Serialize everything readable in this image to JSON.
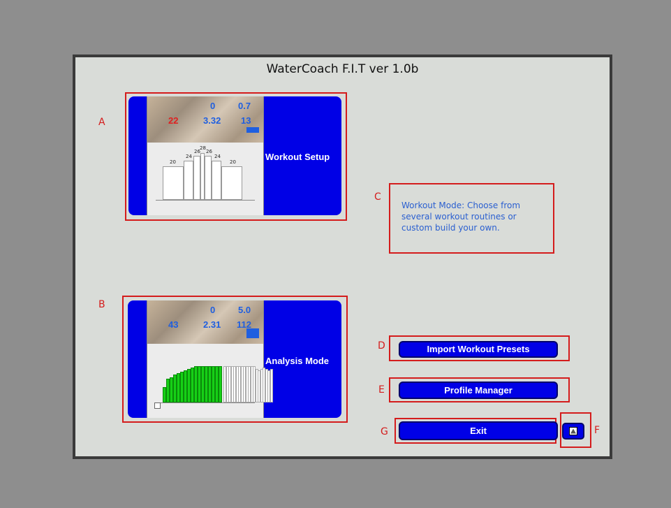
{
  "window": {
    "title": "WaterCoach F.I.T ver 1.0b"
  },
  "annotations": {
    "a": "A",
    "b": "B",
    "c": "C",
    "d": "D",
    "e": "E",
    "f": "F",
    "g": "G"
  },
  "workout_card": {
    "label": "Workout Setup",
    "thumb": {
      "n1": "0",
      "n2": "0.7",
      "n3": "22",
      "n4": "3.32",
      "n5": "13",
      "bars": [
        "20",
        "24",
        "26",
        "28",
        "26",
        "24",
        "20"
      ]
    }
  },
  "analysis_card": {
    "label": "Analysis Mode",
    "thumb": {
      "n1": "0",
      "n2": "5.0",
      "n3": "43",
      "n4": "2.31",
      "n5": "112"
    }
  },
  "description": "Workout Mode: Choose from several workout routines or custom build your own.",
  "buttons": {
    "import": "Import Workout Presets",
    "profile": "Profile Manager",
    "exit": "Exit"
  },
  "icons": {
    "minimize": "up-triangle-icon"
  },
  "colors": {
    "button_blue": "#0000e6",
    "annotation_red": "#d41c1c",
    "description_blue": "#2a5fd0"
  }
}
